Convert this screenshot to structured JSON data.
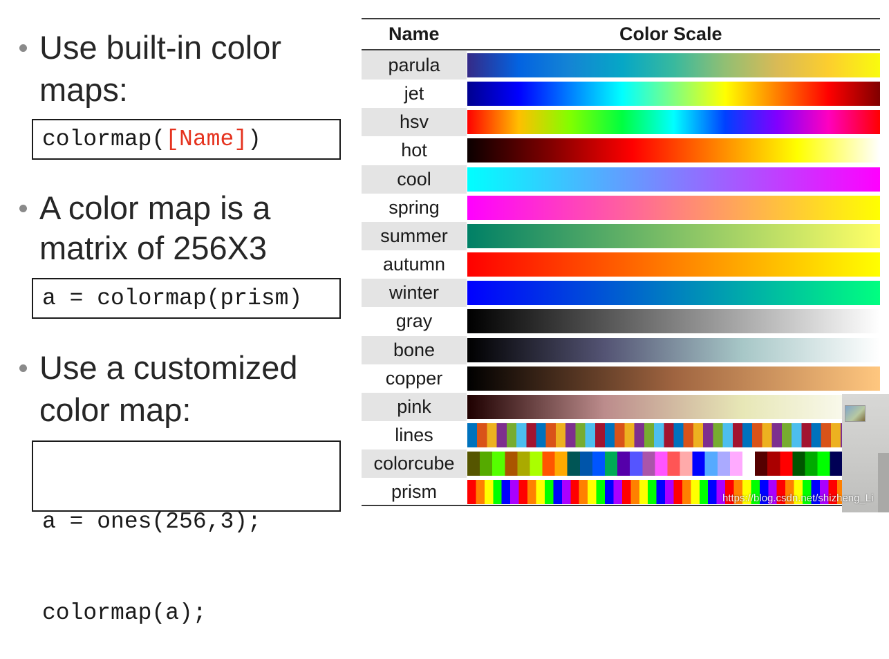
{
  "left": {
    "bullet1": {
      "line1": "Use built-in color",
      "line2": "maps:"
    },
    "code1": {
      "prefix": "colormap(",
      "arg": "[Name]",
      "suffix": ")"
    },
    "bullet2": {
      "line1": "A color map is a",
      "line2": "matrix of 256X3"
    },
    "code2": "a = colormap(prism)",
    "bullet3": {
      "line1": "Use a customized",
      "line2": "color map:"
    },
    "code3": {
      "line1": "a = ones(256,3);",
      "line2": "colormap(a);"
    }
  },
  "table": {
    "header_name": "Name",
    "header_scale": "Color Scale",
    "rows": [
      {
        "name": "parula",
        "colors": [
          "#352a87",
          "#0363e1",
          "#1485d4",
          "#06a7c6",
          "#38b99e",
          "#92bf73",
          "#d9ba56",
          "#fcce2e",
          "#f9fb0e"
        ]
      },
      {
        "name": "jet",
        "colors": [
          "#00008f",
          "#0000ff",
          "#0080ff",
          "#00ffff",
          "#80ff80",
          "#ffff00",
          "#ff8000",
          "#ff0000",
          "#800000"
        ]
      },
      {
        "name": "hsv",
        "colors": [
          "#ff0000",
          "#ffbf00",
          "#80ff00",
          "#00ff40",
          "#00ffff",
          "#0040ff",
          "#8000ff",
          "#ff00bf",
          "#ff0000"
        ]
      },
      {
        "name": "hot",
        "colors": [
          "#0b0000",
          "#800000",
          "#ff0000",
          "#ff8000",
          "#ffff00",
          "#ffffff"
        ]
      },
      {
        "name": "cool",
        "colors": [
          "#00ffff",
          "#ff00ff"
        ]
      },
      {
        "name": "spring",
        "colors": [
          "#ff00ff",
          "#ffff00"
        ]
      },
      {
        "name": "summer",
        "colors": [
          "#008066",
          "#ffff66"
        ]
      },
      {
        "name": "autumn",
        "colors": [
          "#ff0000",
          "#ffff00"
        ]
      },
      {
        "name": "winter",
        "colors": [
          "#0000ff",
          "#00ff80"
        ]
      },
      {
        "name": "gray",
        "colors": [
          "#000000",
          "#ffffff"
        ]
      },
      {
        "name": "bone",
        "colors": [
          "#000000",
          "#545474",
          "#a7c7c7",
          "#ffffff"
        ]
      },
      {
        "name": "copper",
        "colors": [
          "#000000",
          "#9f6440",
          "#ffc77f"
        ]
      },
      {
        "name": "pink",
        "colors": [
          "#1e0000",
          "#bc8c8c",
          "#e7e7b6",
          "#ffffff"
        ]
      },
      {
        "name": "lines",
        "stripes": [
          "#0072bd",
          "#d95319",
          "#edb120",
          "#7e2f8e",
          "#77ac30",
          "#4dbeee",
          "#a2142f"
        ],
        "count": 42
      },
      {
        "name": "colorcube",
        "stripes": [
          "#555500",
          "#55aa00",
          "#55ff00",
          "#aa5500",
          "#aaaa00",
          "#aaff00",
          "#ff5500",
          "#ffaa00",
          "#005555",
          "#0055aa",
          "#0055ff",
          "#00aa55",
          "#5500aa",
          "#5555ff",
          "#aa55aa",
          "#ff55ff",
          "#ff5555",
          "#ffaaaa",
          "#0000ff",
          "#55aaff",
          "#aaaaff",
          "#ffaaff",
          "#ffffff",
          "#550000",
          "#aa0000",
          "#ff0000",
          "#005500",
          "#00aa00",
          "#00ff00",
          "#000055",
          "#0000aa",
          "#0000ff",
          "#000000"
        ],
        "count": 33
      },
      {
        "name": "prism",
        "stripes": [
          "#ff0000",
          "#ff8000",
          "#ffff00",
          "#00ff00",
          "#0000ff",
          "#aa00ff"
        ],
        "count": 48
      }
    ]
  },
  "watermark": "https://blog.csdn.net/shizheng_Li"
}
